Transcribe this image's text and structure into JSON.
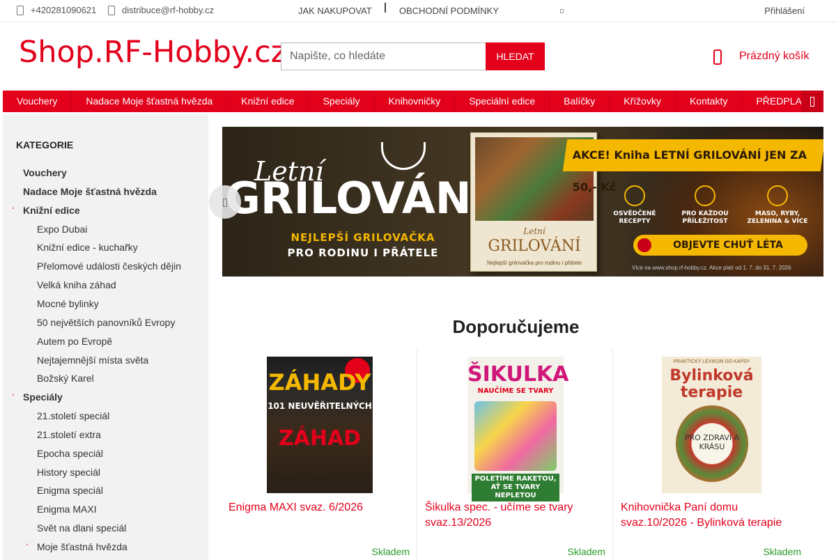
{
  "topbar": {
    "phone": "+420281090621",
    "email": "distribuce@rf-hobby.cz",
    "links": [
      "JAK NAKUPOVAT",
      "OBCHODNÍ PODMÍNKY"
    ],
    "login": "Přihlášení"
  },
  "header": {
    "logo": "Shop.RF-Hobby.cz",
    "search_placeholder": "Napište, co hledáte",
    "search_button": "HLEDAT",
    "cart_label": "Prázdný košík"
  },
  "mainnav": [
    "Vouchery",
    "Nadace Moje šťastná hvězda",
    "Knižní edice",
    "Speciály",
    "Knihovničky",
    "Speciální edice",
    "Balíčky",
    "Křížovky",
    "Kontakty",
    "PŘEDPLA"
  ],
  "sidebar": {
    "title": "KATEGORIE",
    "items": [
      {
        "label": "Vouchery",
        "level": 1,
        "bullet": false
      },
      {
        "label": "Nadace Moje šťastná hvězda",
        "level": 1,
        "bullet": false
      },
      {
        "label": "Knižní edice",
        "level": 1,
        "bullet": true
      },
      {
        "label": "Expo Dubai",
        "level": 2,
        "bullet": false
      },
      {
        "label": "Knižní edice - kuchařky",
        "level": 2,
        "bullet": false
      },
      {
        "label": "Přelomové události českých dějin",
        "level": 2,
        "bullet": false
      },
      {
        "label": "Velká kniha záhad",
        "level": 2,
        "bullet": false
      },
      {
        "label": "Mocné bylinky",
        "level": 2,
        "bullet": false
      },
      {
        "label": "50 největších panovníků Evropy",
        "level": 2,
        "bullet": false
      },
      {
        "label": "Autem po Evropě",
        "level": 2,
        "bullet": false
      },
      {
        "label": "Nejtajemnější místa světa",
        "level": 2,
        "bullet": false
      },
      {
        "label": "Božský Karel",
        "level": 2,
        "bullet": false
      },
      {
        "label": "Speciály",
        "level": 1,
        "bullet": true
      },
      {
        "label": "21.století speciál",
        "level": 2,
        "bullet": false
      },
      {
        "label": "21.století extra",
        "level": 2,
        "bullet": false
      },
      {
        "label": "Epocha speciál",
        "level": 2,
        "bullet": false
      },
      {
        "label": "History speciál",
        "level": 2,
        "bullet": false
      },
      {
        "label": "Enigma speciál",
        "level": 2,
        "bullet": false
      },
      {
        "label": "Enigma MAXI",
        "level": 2,
        "bullet": false
      },
      {
        "label": "Svět na dlani speciál",
        "level": 2,
        "bullet": false
      },
      {
        "label": "Moje šťastná hvězda",
        "level": 2,
        "bullet": true
      }
    ]
  },
  "banner": {
    "line1": "Letní",
    "line2": "GRILOVÁNÍ",
    "line3": "NEJLEPŠÍ GRILOVAČKA",
    "line4": "PRO RODINU I PŘÁTELE",
    "book_small": "Letní",
    "book_title": "GRILOVÁNÍ",
    "book_sub": "Nejlepší grilovačka pro rodinu i přátele",
    "promo": "AKCE! Kniha LETNÍ GRILOVÁNÍ JEN ZA 50,- Kč",
    "features": [
      "OSVĚDČENÉ RECEPTY",
      "PRO KAŽDOU PŘÍLEŽITOST",
      "MASO, RYBY, ZELENINA & VÍCE"
    ],
    "cta": "OBJEVTE CHUŤ LÉTA",
    "fine_print": "Více na www.shop.rf-hobby.cz. Akce platí od 1. 7. do 31. 7. 2026"
  },
  "recommended": {
    "title": "Doporučujeme",
    "products": [
      {
        "name": "Enigma MAXI svaz. 6/2026",
        "stock": "Skladem",
        "cover_title": "ZÁHADY",
        "cover_mid": "101 NEUVĚŘITELNÝCH",
        "cover_big": "ZÁHAD"
      },
      {
        "name": "Šikulka spec. - učíme se tvary svaz.13/2026",
        "stock": "Skladem",
        "cover_title": "ŠIKULKA",
        "cover_sub": "NAUČÍME SE TVARY",
        "cover_foot": "POLETÍME RAKETOU, AŤ SE TVARY NEPLETOU"
      },
      {
        "name": "Knihovnička Paní domu svaz.10/2026 - Bylinková terapie",
        "stock": "Skladem",
        "cover_top": "PRAKTICKÝ LEXIKON DO KAPSY",
        "cover_title": "Bylinková terapie",
        "cover_mid": "PRO ZDRAVÍ A KRÁSU"
      }
    ]
  }
}
